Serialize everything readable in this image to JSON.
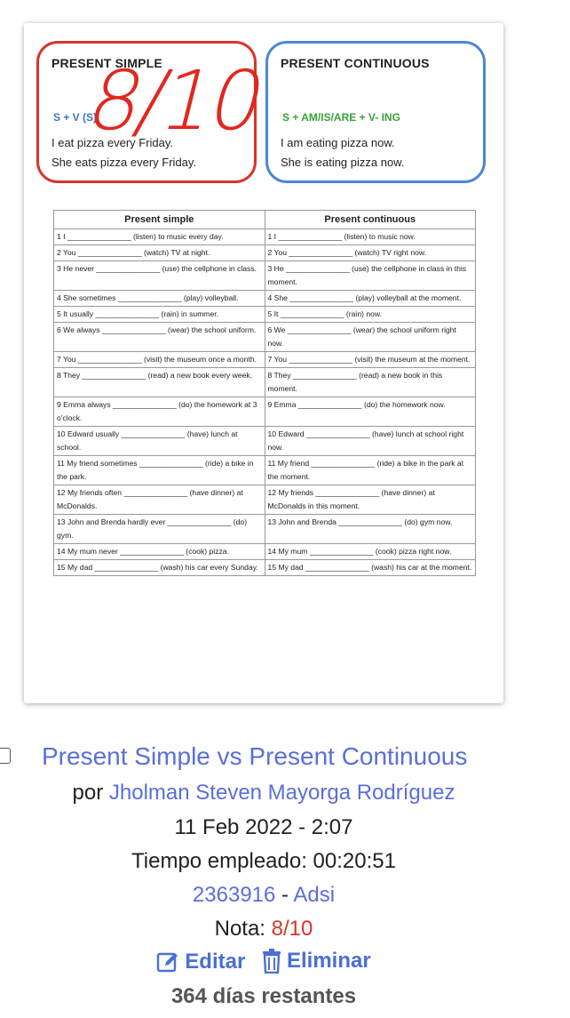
{
  "worksheet": {
    "simple_title": "PRESENT SIMPLE",
    "cont_title": "PRESENT CONTINUOUS",
    "simple_formula": "S + V (S)",
    "cont_formula": "S + AM/IS/ARE + V- ING",
    "simple_ex1": "I    eat pizza every Friday.",
    "simple_ex2": "She eats   pizza every Friday.",
    "cont_ex1": "I    am    eating pizza now.",
    "cont_ex2": "She   is     eating pizza now.",
    "grade_overlay": "8/10",
    "col_simple": "Present simple",
    "col_cont": "Present continuous",
    "rows": [
      [
        "1 I _______________ (listen) to music every day.",
        "1 I _______________ (listen) to music now."
      ],
      [
        "2 You _______________ (watch) TV at night.",
        "2 You _______________ (watch) TV right now."
      ],
      [
        "3 He never _______________ (use) the cellphone in class.",
        "3 He _______________ (use) the cellphone in class in this moment."
      ],
      [
        "4 She sometimes _______________ (play) volleyball.",
        "4 She _______________ (play) volleyball at the moment."
      ],
      [
        "5 It usually _______________ (rain) in summer.",
        "5 It _______________ (rain) now."
      ],
      [
        "6 We always _______________ (wear) the school uniform.",
        "6 We _______________ (wear) the school uniform right now."
      ],
      [
        "7 You _______________ (visit) the museum once a month.",
        "7 You _______________ (visit) the museum at the moment."
      ],
      [
        "8 They _______________ (read) a new book every week.",
        "8 They _______________ (read) a new book in this moment."
      ],
      [
        "9 Emma always _______________ (do) the homework at 3 o'clock.",
        "9 Emma _______________ (do) the homework now."
      ],
      [
        "10 Edward usually _______________ (have) lunch at school.",
        "10 Edward _______________ (have) lunch at school right now."
      ],
      [
        "11 My friend sometimes _______________ (ride) a bike in the park.",
        "11 My friend _______________ (ride) a bike in the park at the moment."
      ],
      [
        "12 My friends often _______________ (have dinner) at McDonalds.",
        "12 My friends _______________ (have dinner) at McDonalds in this moment."
      ],
      [
        "13 John and Brenda hardly ever _______________ (do) gym.",
        "13 John and Brenda _______________ (do) gym now."
      ],
      [
        "14 My mum never _______________ (cook) pizza.",
        "14 My mum _______________ (cook) pizza right now."
      ],
      [
        "15 My dad _______________ (wash) his car every Sunday.",
        "15 My dad _______________ (wash) his car at the moment."
      ]
    ]
  },
  "entry": {
    "title": "Present Simple vs Present Continuous",
    "author_prefix": "por",
    "author": "Jholman Steven Mayorga Rodríguez",
    "date": "11 Feb 2022 - 2:07",
    "time_spent": "Tiempo empleado: 00:20:51",
    "id": "2363916",
    "separator": "-",
    "group": "Adsi",
    "grade_label": "Nota:",
    "grade": "8/10",
    "edit_label": "Editar",
    "delete_label": "Eliminar",
    "remaining": "364 días restantes"
  },
  "colors": {
    "link": "#5a6fd8",
    "grade": "#d9342b",
    "simple_border": "#d9342b",
    "cont_border": "#4c87d6"
  },
  "icons": {
    "edit": "edit-icon",
    "delete": "trash-icon"
  }
}
